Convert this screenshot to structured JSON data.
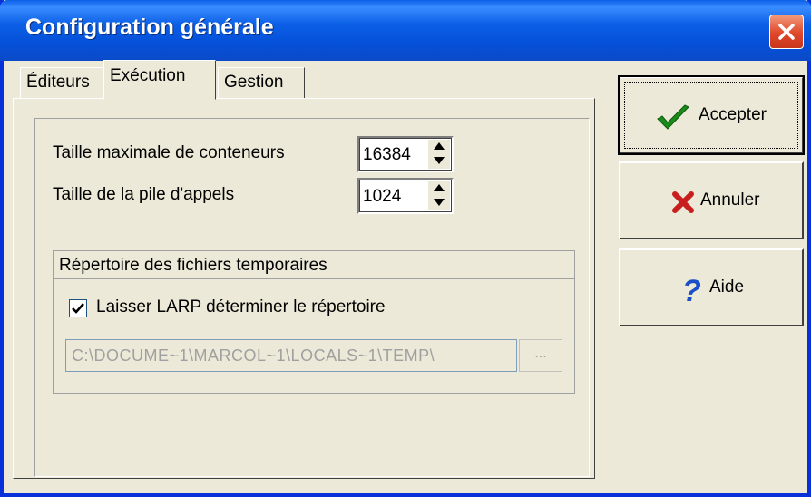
{
  "window": {
    "title": "Configuration générale"
  },
  "tabs": [
    {
      "label": "Éditeurs"
    },
    {
      "label": "Exécution"
    },
    {
      "label": "Gestion"
    }
  ],
  "execution": {
    "max_containers": {
      "label": "Taille maximale de conteneurs",
      "value": "16384"
    },
    "call_stack": {
      "label": "Taille de la pile d'appels",
      "value": "1024"
    },
    "temp_group": {
      "title": "Répertoire des fichiers temporaires",
      "checkbox_label": "Laisser LARP déterminer le répertoire",
      "checked": true,
      "path": "C:\\DOCUME~1\\MARCOL~1\\LOCALS~1\\TEMP\\",
      "browse_label": "..."
    }
  },
  "buttons": {
    "accept": {
      "label": "Accepter",
      "icon": "checkmark-icon",
      "color": "#1a8a1a"
    },
    "cancel": {
      "label": "Annuler",
      "icon": "x-icon",
      "color": "#c81e1e"
    },
    "help": {
      "label": "Aide",
      "icon": "question-icon",
      "color": "#1a4fc8"
    }
  }
}
